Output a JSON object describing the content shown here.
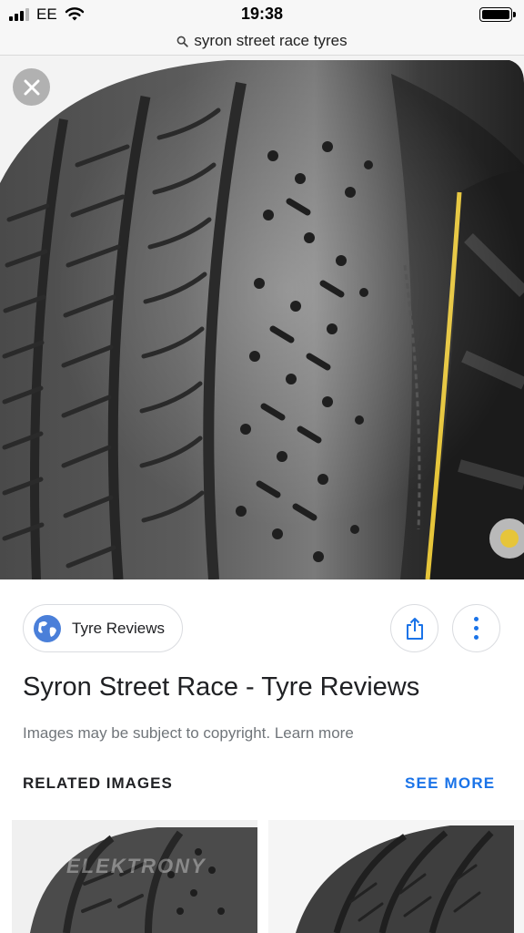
{
  "status_bar": {
    "carrier": "EE",
    "time": "19:38"
  },
  "url_bar": {
    "query": "syron street race tyres",
    "icon": "search-icon"
  },
  "viewer": {
    "close_icon": "close-icon",
    "colors": {
      "tyre": "#2b2b2b",
      "rim_stripe": "#e6c53a"
    }
  },
  "source": {
    "label": "Tyre Reviews",
    "icon": "globe-icon"
  },
  "actions": {
    "share_icon": "share-icon",
    "more_icon": "more-vert-icon"
  },
  "result": {
    "title": "Syron Street Race - Tyre Reviews",
    "copyright": "Images may be subject to copyright. Learn more"
  },
  "related": {
    "heading": "RELATED IMAGES",
    "see_more": "SEE MORE",
    "thumbnails": [
      {
        "watermark": "ELEKTRONY"
      },
      {
        "watermark": ""
      }
    ]
  },
  "colors": {
    "accent": "#1a73e8",
    "text_primary": "#202124",
    "text_secondary": "#70757a",
    "border": "#dadce0"
  }
}
